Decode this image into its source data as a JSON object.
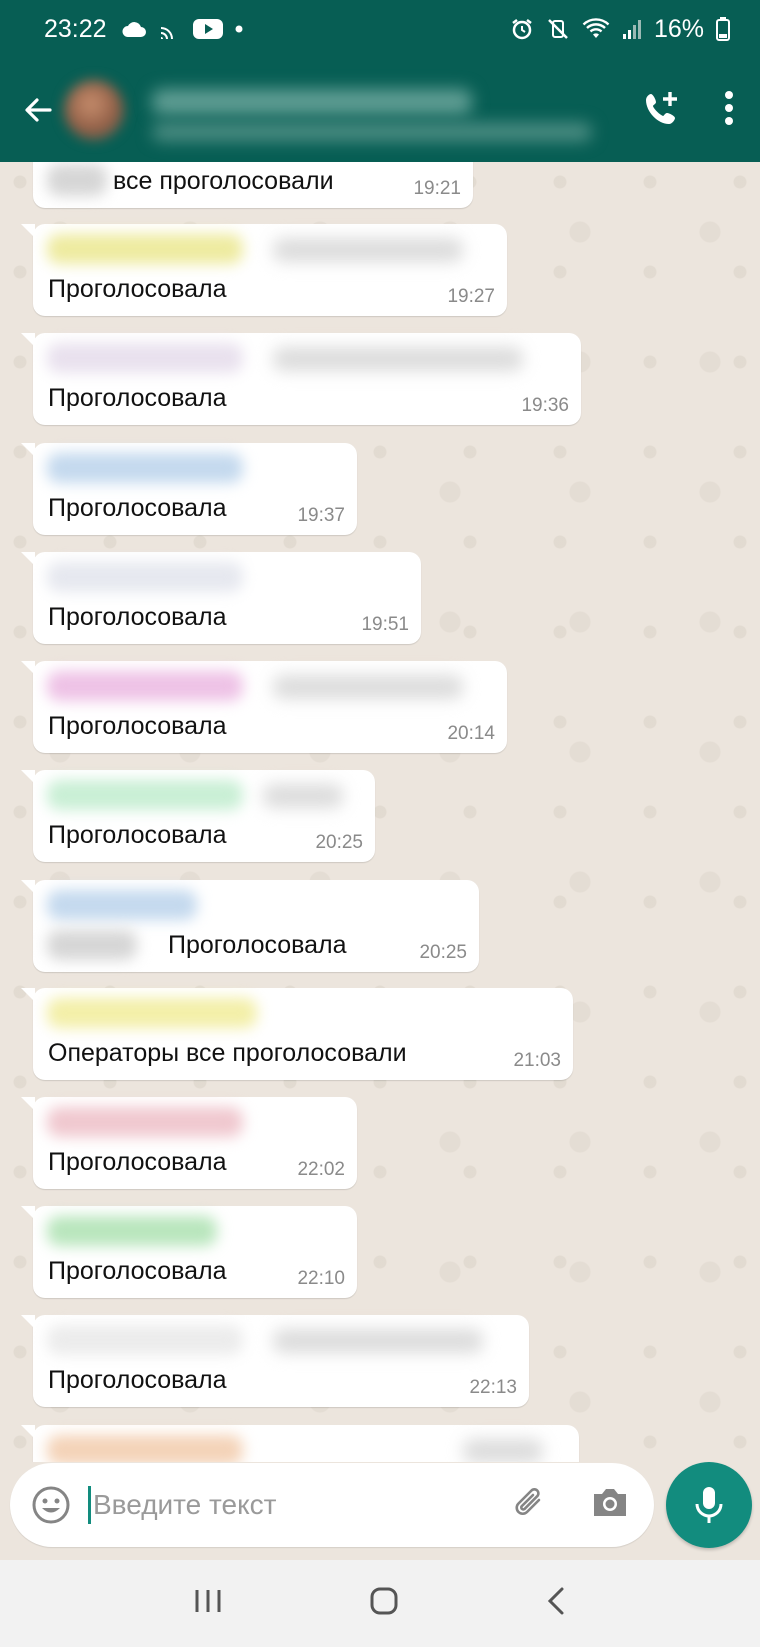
{
  "status_bar": {
    "time": "23:22",
    "battery": "16%"
  },
  "header": {
    "icons": [
      "back-arrow-icon",
      "add-call-icon",
      "more-vert-icon"
    ]
  },
  "messages": [
    {
      "text": "все проголосовали",
      "time": "19:21"
    },
    {
      "text": "Проголосовала",
      "time": "19:27"
    },
    {
      "text": "Проголосовала",
      "time": "19:36"
    },
    {
      "text": "Проголосовала",
      "time": "19:37"
    },
    {
      "text": "Проголосовала",
      "time": "19:51"
    },
    {
      "text": "Проголосовала",
      "time": "20:14"
    },
    {
      "text": "Проголосовала",
      "time": "20:25"
    },
    {
      "text": "Проголосовала",
      "time": "20:25"
    },
    {
      "text": "Операторы все проголосовали",
      "time": "21:03"
    },
    {
      "text": "Проголосовала",
      "time": "22:02"
    },
    {
      "text": "Проголосовала",
      "time": "22:10"
    },
    {
      "text": "Проголосовала",
      "time": "22:13"
    }
  ],
  "input": {
    "placeholder": "Введите текст"
  },
  "colors": {
    "header": "#075e54",
    "accent": "#128c7e",
    "chat_background": "#ece5dd",
    "bubble": "#ffffff"
  }
}
